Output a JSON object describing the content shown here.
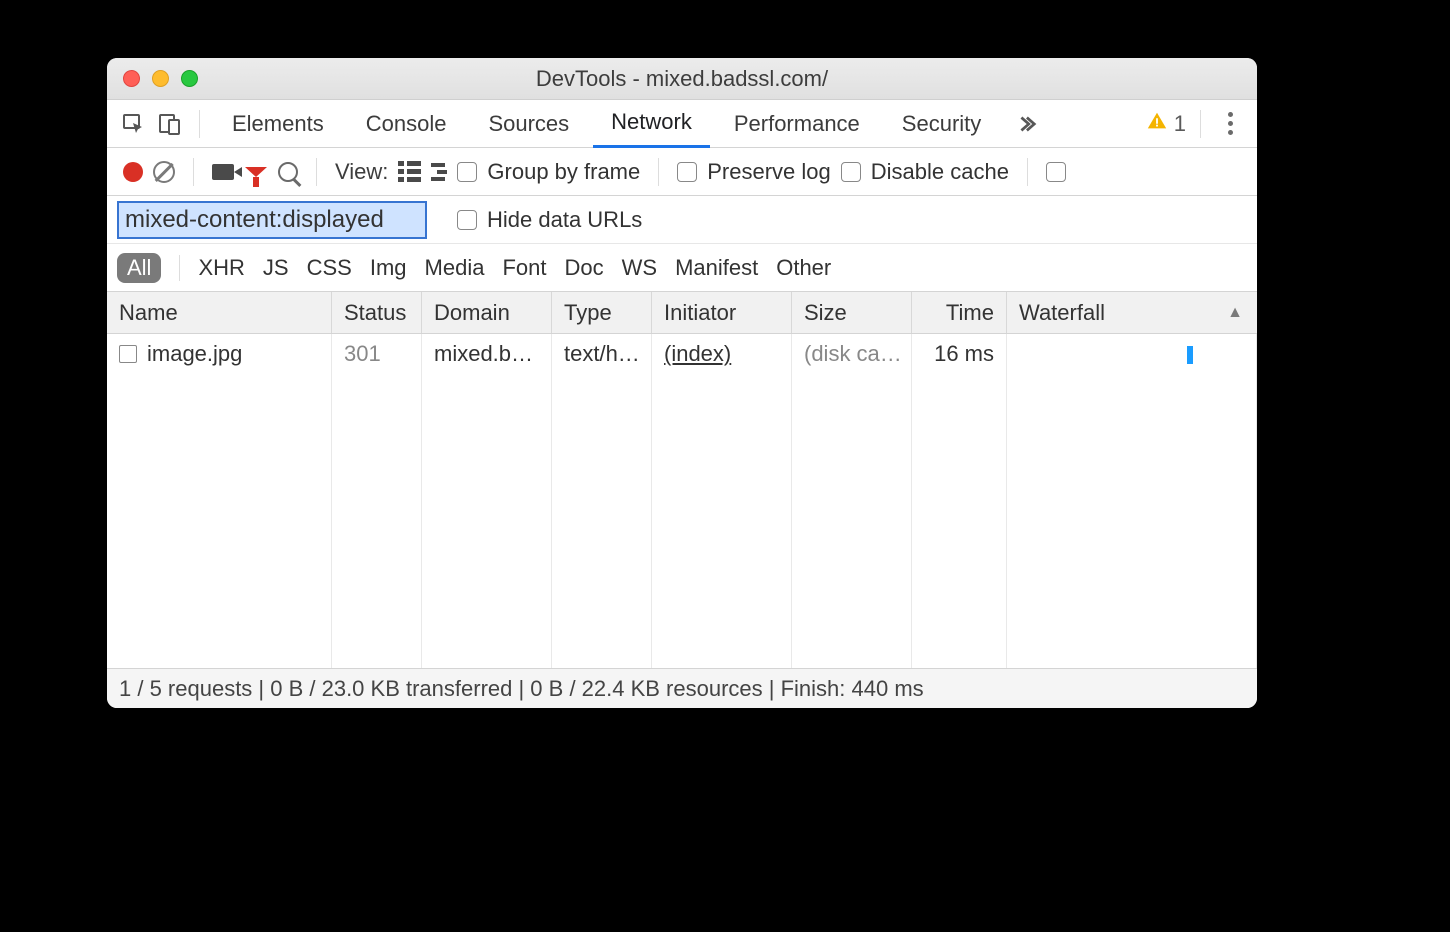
{
  "window": {
    "title": "DevTools - mixed.badssl.com/"
  },
  "warnings": {
    "count": "1"
  },
  "tabs": [
    "Elements",
    "Console",
    "Sources",
    "Network",
    "Performance",
    "Security"
  ],
  "active_tab": "Network",
  "toolbar": {
    "view_label": "View:",
    "group_by_frame": "Group by frame",
    "preserve_log": "Preserve log",
    "disable_cache": "Disable cache"
  },
  "filter": {
    "value": "mixed-content:displayed",
    "hide_data_urls": "Hide data URLs"
  },
  "type_filters": [
    "All",
    "XHR",
    "JS",
    "CSS",
    "Img",
    "Media",
    "Font",
    "Doc",
    "WS",
    "Manifest",
    "Other"
  ],
  "active_type_filter": "All",
  "columns": [
    "Name",
    "Status",
    "Domain",
    "Type",
    "Initiator",
    "Size",
    "Time",
    "Waterfall"
  ],
  "rows": [
    {
      "name": "image.jpg",
      "status": "301",
      "domain": "mixed.b…",
      "type": "text/h…",
      "initiator": "(index)",
      "size": "(disk ca…",
      "time": "16 ms"
    }
  ],
  "status": "1 / 5 requests | 0 B / 23.0 KB transferred | 0 B / 22.4 KB resources | Finish: 440 ms"
}
